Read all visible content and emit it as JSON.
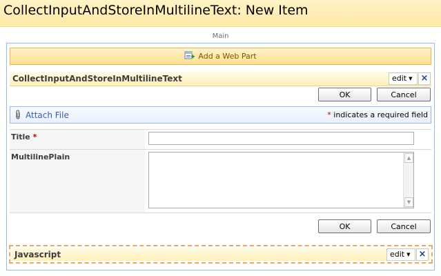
{
  "page": {
    "title": "CollectInputAndStoreInMultilineText: New Item",
    "zone_label": "Main"
  },
  "add_web_part": {
    "label": "Add a Web Part",
    "icon": "add-webpart-icon"
  },
  "webpart_form": {
    "title": "CollectInputAndStoreInMultilineText",
    "edit_label": "edit",
    "close_symbol": "×",
    "buttons": {
      "ok": "OK",
      "cancel": "Cancel"
    },
    "toolbar": {
      "attach_label": "Attach File",
      "attach_icon": "paperclip-icon",
      "required_star": "*",
      "required_text": " indicates a required field"
    },
    "fields": [
      {
        "label": "Title",
        "required_star": "*",
        "value": ""
      },
      {
        "label": "MultilinePlain",
        "value": ""
      }
    ]
  },
  "webpart_js": {
    "title": "Javascript",
    "edit_label": "edit",
    "close_symbol": "×"
  },
  "colors": {
    "title_bar": "#ffe9a6",
    "zone_border": "#95b7f3",
    "link": "#3a5ca8",
    "required": "#bf0000",
    "dashed_border": "#f2a65a"
  }
}
